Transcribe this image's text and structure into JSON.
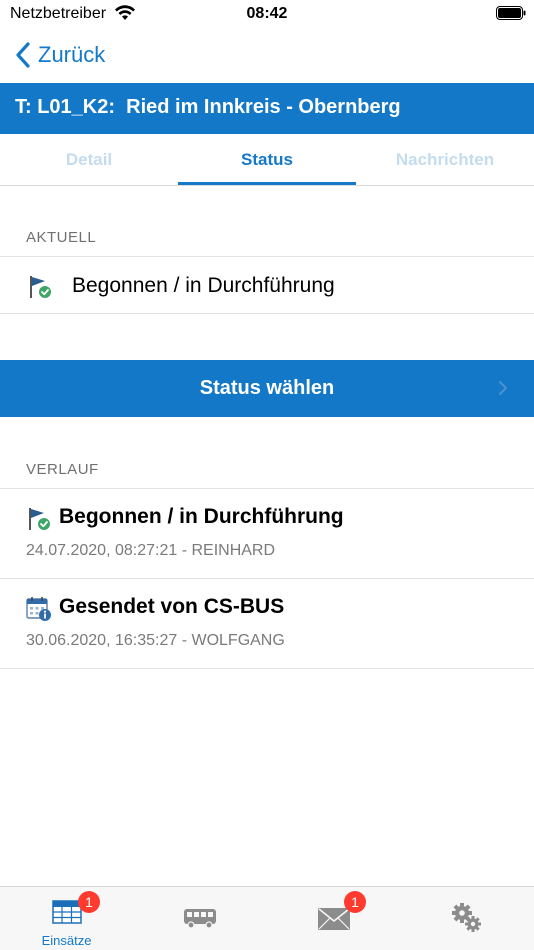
{
  "status_bar": {
    "carrier": "Netzbetreiber",
    "time": "08:42",
    "wifi_icon": "wifi-icon",
    "battery_icon": "battery-icon"
  },
  "nav": {
    "back_label": "Zurück"
  },
  "header": {
    "title": "T: L01_K2:  Ried im Innkreis - Obernberg"
  },
  "tabs": [
    {
      "label": "Detail",
      "active": false
    },
    {
      "label": "Status",
      "active": true
    },
    {
      "label": "Nachrichten",
      "active": false
    }
  ],
  "current": {
    "section_label": "AKTUELL",
    "status": "Begonnen / in Durchführung",
    "icon": "flag-check-icon"
  },
  "action": {
    "label": "Status wählen"
  },
  "history": {
    "section_label": "VERLAUF",
    "items": [
      {
        "title": "Begonnen / in Durchführung",
        "meta": "24.07.2020, 08:27:21 - REINHARD",
        "icon": "flag-check-icon"
      },
      {
        "title": "Gesendet von CS-BUS",
        "meta": "30.06.2020, 16:35:27 - WOLFGANG",
        "icon": "calendar-info-icon"
      }
    ]
  },
  "tabbar": {
    "items": [
      {
        "label": "Einsätze",
        "icon": "table-grid-icon",
        "badge": "1"
      },
      {
        "label": "",
        "icon": "bus-icon",
        "badge": ""
      },
      {
        "label": "",
        "icon": "mail-icon",
        "badge": "1"
      },
      {
        "label": "",
        "icon": "gears-icon",
        "badge": ""
      }
    ]
  },
  "colors": {
    "accent": "#1478c8",
    "badge": "#ff3b30",
    "inactive_tab": "#c4dcef",
    "check_green": "#3fa66a"
  }
}
